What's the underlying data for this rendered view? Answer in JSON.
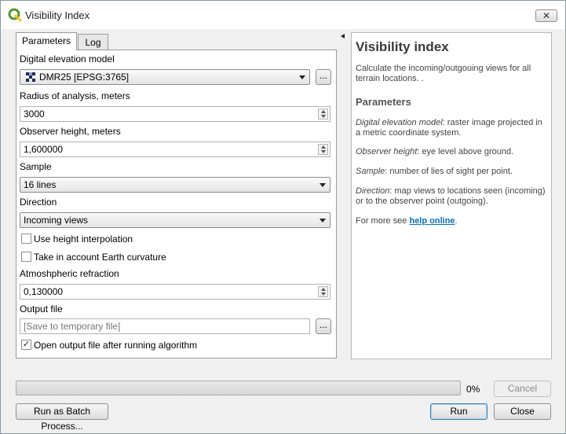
{
  "window": {
    "title": "Visibility Index",
    "close_glyph": "✕",
    "icon": "qgis-logo-icon",
    "accent_color": "#589632"
  },
  "tabs": [
    {
      "label": "Parameters",
      "active": true
    },
    {
      "label": "Log",
      "active": false
    }
  ],
  "params": {
    "dem": {
      "label": "Digital elevation model",
      "value": "DMR25 [EPSG:3765]",
      "browse": "..."
    },
    "radius": {
      "label": "Radius of analysis, meters",
      "value": "3000"
    },
    "observer_height": {
      "label": "Observer height, meters",
      "value": "1,600000"
    },
    "sample": {
      "label": "Sample",
      "value": "16 lines"
    },
    "direction": {
      "label": "Direction",
      "value": "Incoming views"
    },
    "height_interp": {
      "label": "Use height interpolation",
      "checked": false
    },
    "earth_curv": {
      "label": "Take in account Earth curvature",
      "checked": false
    },
    "refraction": {
      "label": "Atmoshpheric refraction",
      "value": "0,130000"
    },
    "output": {
      "label": "Output file",
      "placeholder": "[Save to temporary file]",
      "browse": "..."
    },
    "open_after": {
      "label": "Open output file after running algorithm",
      "checked": true,
      "mark": "✓"
    }
  },
  "help": {
    "title": "Visibility index",
    "description": "Calculate the incoming/outgouing views for all terrain locations. .",
    "parameters_heading": "Parameters",
    "dem_term": "Digital elevation model",
    "dem_text": ": raster image projected in a metric coordinate system.",
    "obs_term": "Observer height",
    "obs_text": ": eye level above ground.",
    "sample_term": "Sample",
    "sample_text": ": number of lies of sight per point.",
    "dir_term": "Direction",
    "dir_text": ": map views to locations seen (incoming) or to the observer point (outgoing).",
    "more_text": "For more see ",
    "link_text": "help online",
    "more_end": "."
  },
  "progress": {
    "value": 0,
    "text": "0%"
  },
  "buttons": {
    "cancel": "Cancel",
    "batch": "Run as Batch Process...",
    "run": "Run",
    "close": "Close"
  }
}
